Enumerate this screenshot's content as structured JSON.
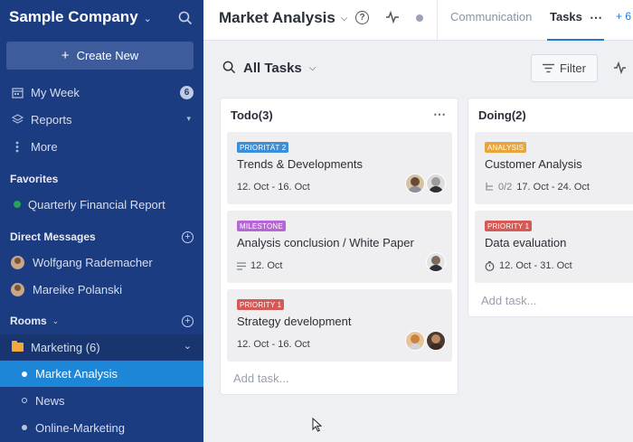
{
  "sidebar": {
    "company": "Sample Company",
    "create_label": "Create New",
    "nav": [
      {
        "label": "My Week",
        "badge": "6",
        "icon": "calendar-icon"
      },
      {
        "label": "Reports",
        "icon": "layers-icon"
      },
      {
        "label": "More",
        "icon": "more-vertical-icon"
      }
    ],
    "favorites_heading": "Favorites",
    "favorites": [
      {
        "label": "Quarterly Financial Report"
      }
    ],
    "dm_heading": "Direct Messages",
    "dms": [
      {
        "label": "Wolfgang Rademacher"
      },
      {
        "label": "Mareike Polanski"
      }
    ],
    "rooms_heading": "Rooms",
    "rooms": [
      {
        "label": "Marketing (6)",
        "icon": "folder-icon"
      },
      {
        "label": "Market Analysis",
        "active": true
      },
      {
        "label": "News"
      },
      {
        "label": "Online-Marketing"
      }
    ]
  },
  "header": {
    "title": "Market Analysis",
    "tabs": [
      "Communication",
      "Tasks"
    ],
    "active_tab": "Tasks",
    "extra": "+ 6"
  },
  "toolbar": {
    "title": "All Tasks",
    "filter_label": "Filter"
  },
  "columns": [
    {
      "title": "Todo(3)",
      "cards": [
        {
          "tag": "PRIORITÄT 2",
          "tag_color": "#3d8ed8",
          "title": "Trends & Developments",
          "meta": "12. Oct - 16. Oct"
        },
        {
          "tag": "MILESTONE",
          "tag_color": "#b665d6",
          "title": "Analysis conclusion / White Paper",
          "meta": "12. Oct"
        },
        {
          "tag": "PRIORITY 1",
          "tag_color": "#d45a57",
          "title": "Strategy development",
          "meta": "12. Oct - 16. Oct"
        }
      ],
      "add_label": "Add task..."
    },
    {
      "title": "Doing(2)",
      "cards": [
        {
          "tag": "ANALYSIS",
          "tag_color": "#eaa53a",
          "title": "Customer Analysis",
          "subtasks": "0/2",
          "meta": "17. Oct - 24. Oct"
        },
        {
          "tag": "PRIORITY 1",
          "tag_color": "#d45a57",
          "title": "Data evaluation",
          "meta": "12. Oct - 31. Oct"
        }
      ],
      "add_label": "Add task..."
    }
  ],
  "colors": {
    "sidebar": "#1c3c82",
    "active": "#1e86d6",
    "accent": "#1f7ad6"
  }
}
